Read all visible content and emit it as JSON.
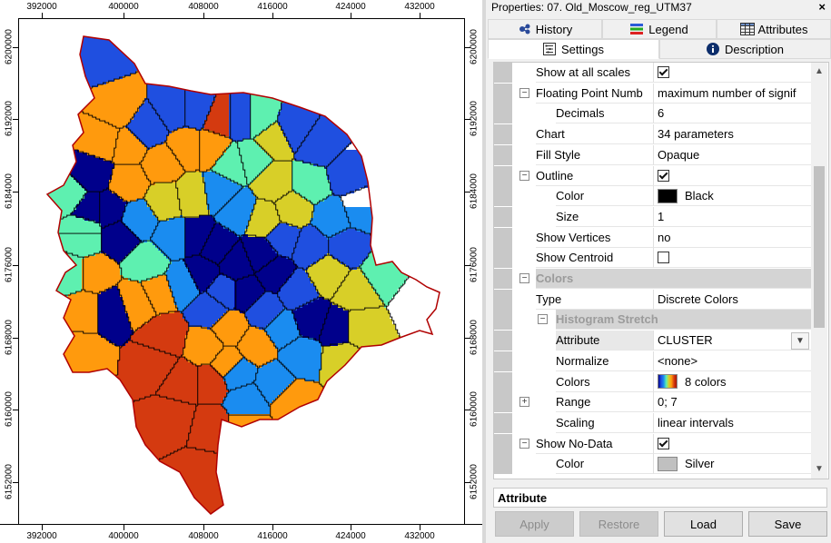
{
  "map": {
    "x_ticks": [
      "392000",
      "400000",
      "408000",
      "416000",
      "424000",
      "432000"
    ],
    "y_ticks": [
      "6200000",
      "6192000",
      "6184000",
      "6176000",
      "6168000",
      "6160000",
      "6152000"
    ]
  },
  "panel": {
    "title": "Properties: 07. Old_Moscow_reg_UTM37",
    "close": "×",
    "tabs_row1": [
      {
        "label": "History",
        "icon": "history-icon"
      },
      {
        "label": "Legend",
        "icon": "legend-icon"
      },
      {
        "label": "Attributes",
        "icon": "table-icon"
      }
    ],
    "tabs_row2": [
      {
        "label": "Settings",
        "icon": "settings-icon"
      },
      {
        "label": "Description",
        "icon": "info-icon"
      }
    ],
    "rows": [
      {
        "name": "Show at all scales",
        "value": "",
        "check": true
      },
      {
        "name": "Floating Point Numb",
        "value": "maximum number of signif",
        "expander": "−"
      },
      {
        "name": "Decimals",
        "value": "6"
      },
      {
        "name": "Chart",
        "value": "34 parameters"
      },
      {
        "name": "Fill Style",
        "value": "Opaque"
      },
      {
        "name": "Outline",
        "value": "",
        "check": true,
        "expander": "−"
      },
      {
        "name": "Color",
        "value": "Black",
        "swatch": "#000000"
      },
      {
        "name": "Size",
        "value": "1"
      },
      {
        "name": "Show Vertices",
        "value": "no"
      },
      {
        "name": "Show Centroid",
        "value": "",
        "check": false
      },
      {
        "name": "Colors",
        "value": "",
        "category": true
      },
      {
        "name": "Type",
        "value": "Discrete Colors"
      },
      {
        "name": "Histogram Stretch",
        "value": "",
        "category": true
      },
      {
        "name": "Attribute",
        "value": "CLUSTER",
        "dropdown": true
      },
      {
        "name": "Normalize",
        "value": "<none>"
      },
      {
        "name": "Colors",
        "value": "8 colors",
        "rainbow": true
      },
      {
        "name": "Range",
        "value": "0; 7",
        "expander": "+"
      },
      {
        "name": "Scaling",
        "value": "linear intervals"
      },
      {
        "name": "Show No-Data",
        "value": "",
        "check": true,
        "expander": "−"
      },
      {
        "name": "Color",
        "value": "Silver",
        "swatch": "#c0c0c0"
      }
    ],
    "description_label": "Attribute",
    "buttons": {
      "apply": "Apply",
      "restore": "Restore",
      "load": "Load",
      "save": "Save"
    }
  },
  "colors": {
    "cluster_palette": [
      "#00008b",
      "#1f4fe0",
      "#1a8cf0",
      "#5ef0b0",
      "#d8cf28",
      "#ff9a0d",
      "#d43a10",
      "#a81405"
    ],
    "outline": "#000000",
    "boundary": "#b00000"
  }
}
